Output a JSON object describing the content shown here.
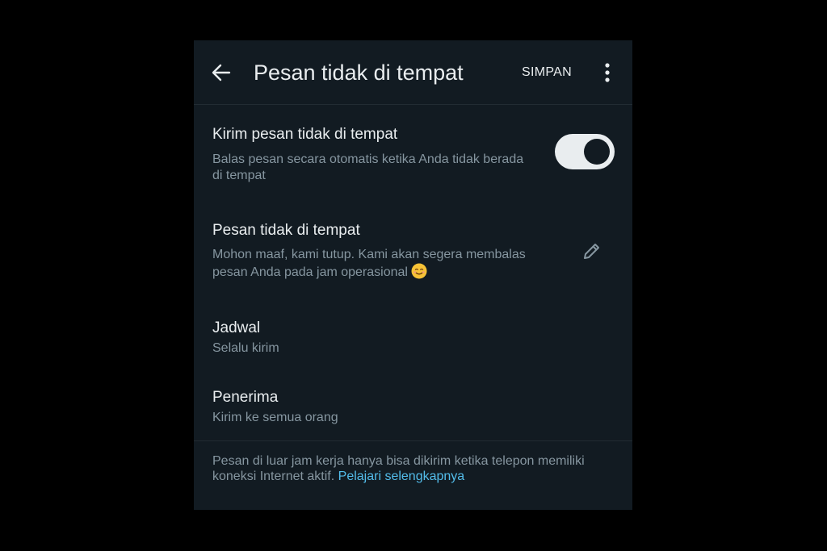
{
  "header": {
    "title": "Pesan tidak di tempat",
    "save_label": "SIMPAN",
    "back_icon": "arrow-left-icon",
    "menu_icon": "more-vertical-icon"
  },
  "away_toggle": {
    "title": "Kirim pesan tidak di tempat",
    "subtitle": "Balas pesan secara otomatis ketika Anda tidak berada di tempat",
    "enabled": true
  },
  "away_message": {
    "title": "Pesan tidak di tempat",
    "body": "Mohon maaf, kami tutup. Kami akan segera membalas pesan Anda pada jam operasional",
    "emoji": "smiling-face-emoji",
    "edit_icon": "pencil-icon"
  },
  "schedule": {
    "title": "Jadwal",
    "value": "Selalu kirim"
  },
  "recipients": {
    "title": "Penerima",
    "value": "Kirim ke semua orang"
  },
  "footer": {
    "text": "Pesan di luar jam kerja hanya bisa dikirim ketika telepon memiliki koneksi Internet aktif.",
    "link_label": "Pelajari selengkapnya"
  },
  "colors": {
    "background": "#121b22",
    "primary_text": "#e9edef",
    "secondary_text": "#8696a0",
    "link": "#53bdeb"
  }
}
